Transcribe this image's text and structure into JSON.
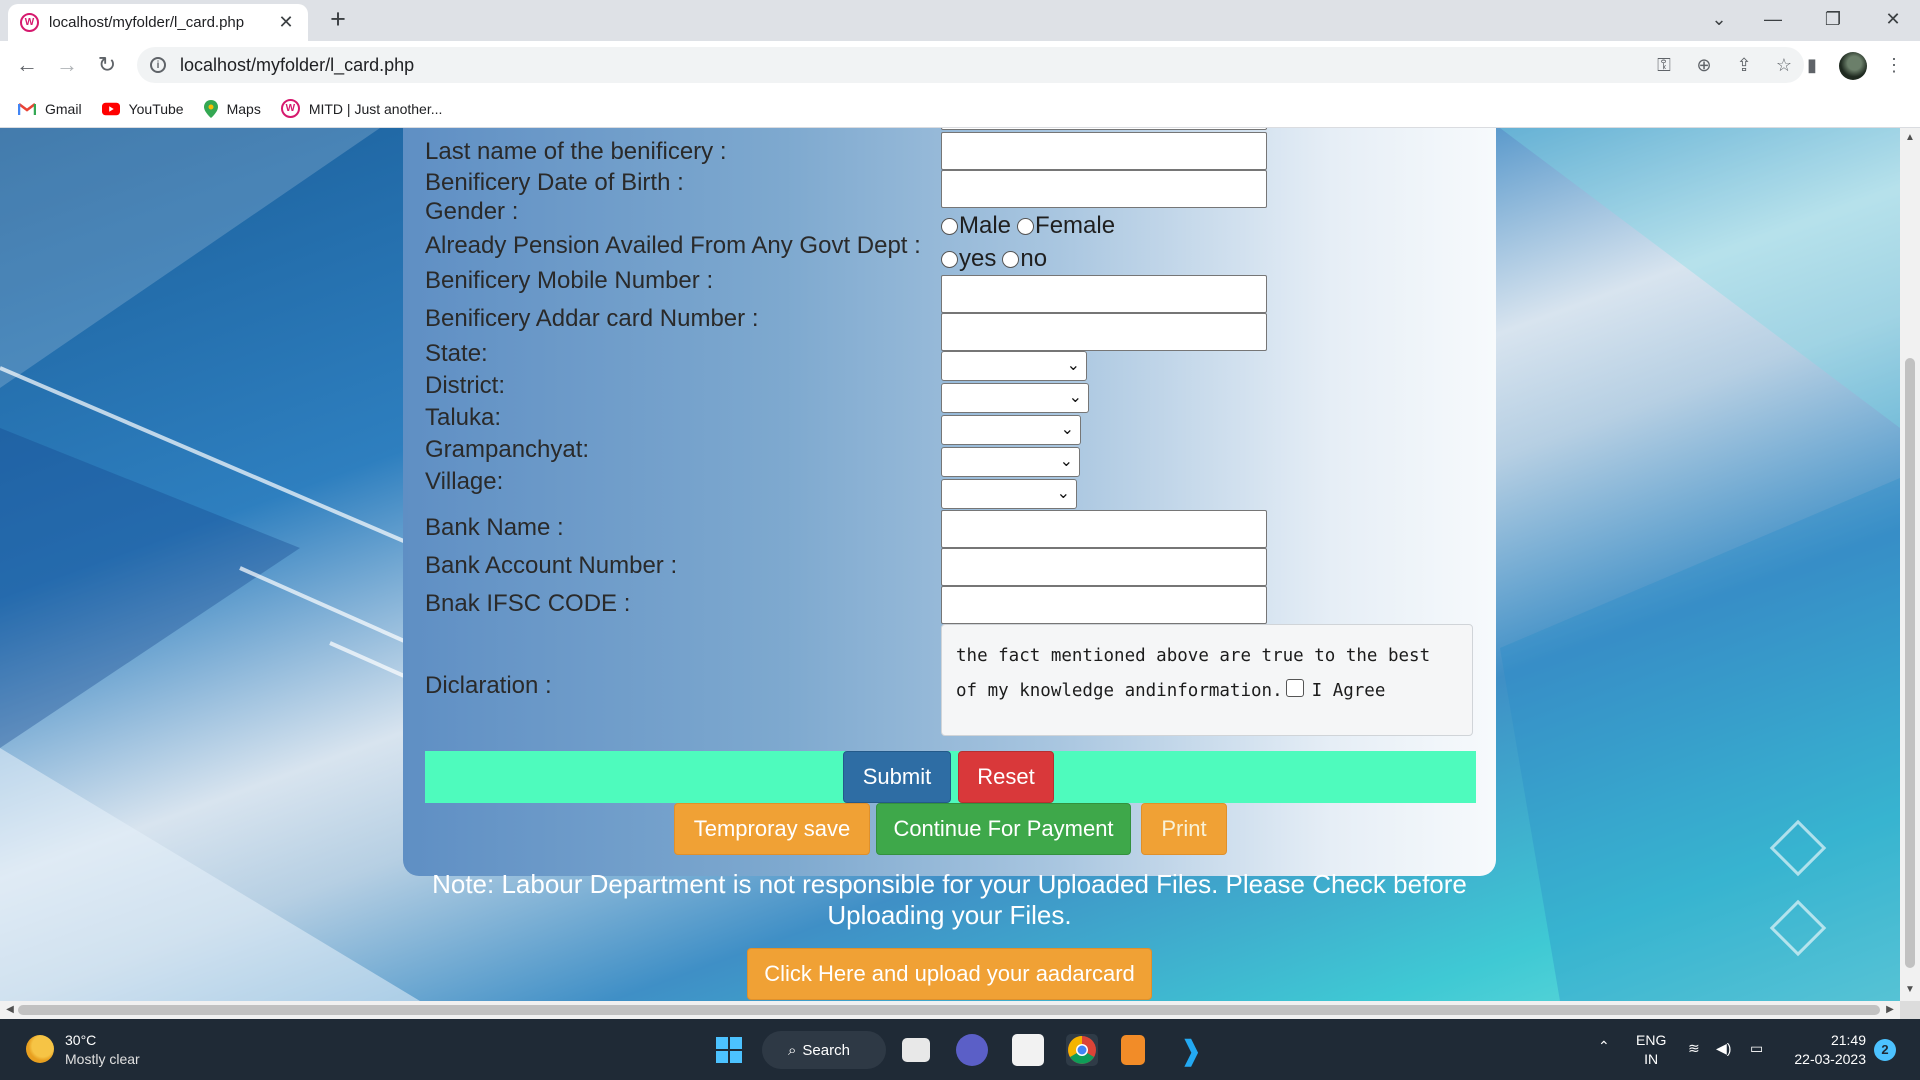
{
  "browser": {
    "tab_title": "localhost/myfolder/l_card.php",
    "tab_close": "✕",
    "new_tab": "+",
    "url": "localhost/myfolder/l_card.php",
    "bookmarks": [
      "Gmail",
      "YouTube",
      "Maps",
      "MITD | Just another..."
    ]
  },
  "form": {
    "labels": {
      "last_name": "Last name of the benificery :",
      "dob": "Benificery Date of Birth :",
      "gender": "Gender :",
      "pension": "Already Pension Availed From Any Govt Dept :",
      "mobile": "Benificery Mobile Number :",
      "aadhar": "Benificery Addar card Number :",
      "state": "State:",
      "district": "District:",
      "taluka": "Taluka:",
      "grampanchayat": "Grampanchyat:",
      "village": "Village:",
      "bank_name": "Bank Name :",
      "account": "Bank Account Number :",
      "ifsc": "Bnak IFSC CODE :",
      "declaration": "Diclaration :"
    },
    "gender_options": [
      "Male",
      "Female"
    ],
    "pension_options": [
      "yes",
      "no"
    ],
    "declaration_line1": "the fact mentioned above are true to the best",
    "declaration_line2": "of my knowledge andinformation.",
    "agree_label": "I Agree",
    "buttons": {
      "submit": "Submit",
      "reset": "Reset",
      "temp_save": "Temproray save",
      "continue": "Continue For Payment",
      "print": "Print"
    }
  },
  "note": "Note: Labour Department is not responsible for your Uploaded Files. Please Check before Uploading your Files.",
  "upload_button": "Click Here and upload your aadarcard",
  "taskbar": {
    "temp": "30°C",
    "weather": "Mostly clear",
    "search": "Search",
    "lang1": "ENG",
    "lang2": "IN",
    "time": "21:49",
    "date": "22-03-2023",
    "notifications": "2"
  },
  "colors": {
    "green_bar": "#4efbbd",
    "submit": "#2e6da4",
    "reset": "#d9383a",
    "orange": "#f0a135",
    "green_button": "#3ea84a"
  }
}
